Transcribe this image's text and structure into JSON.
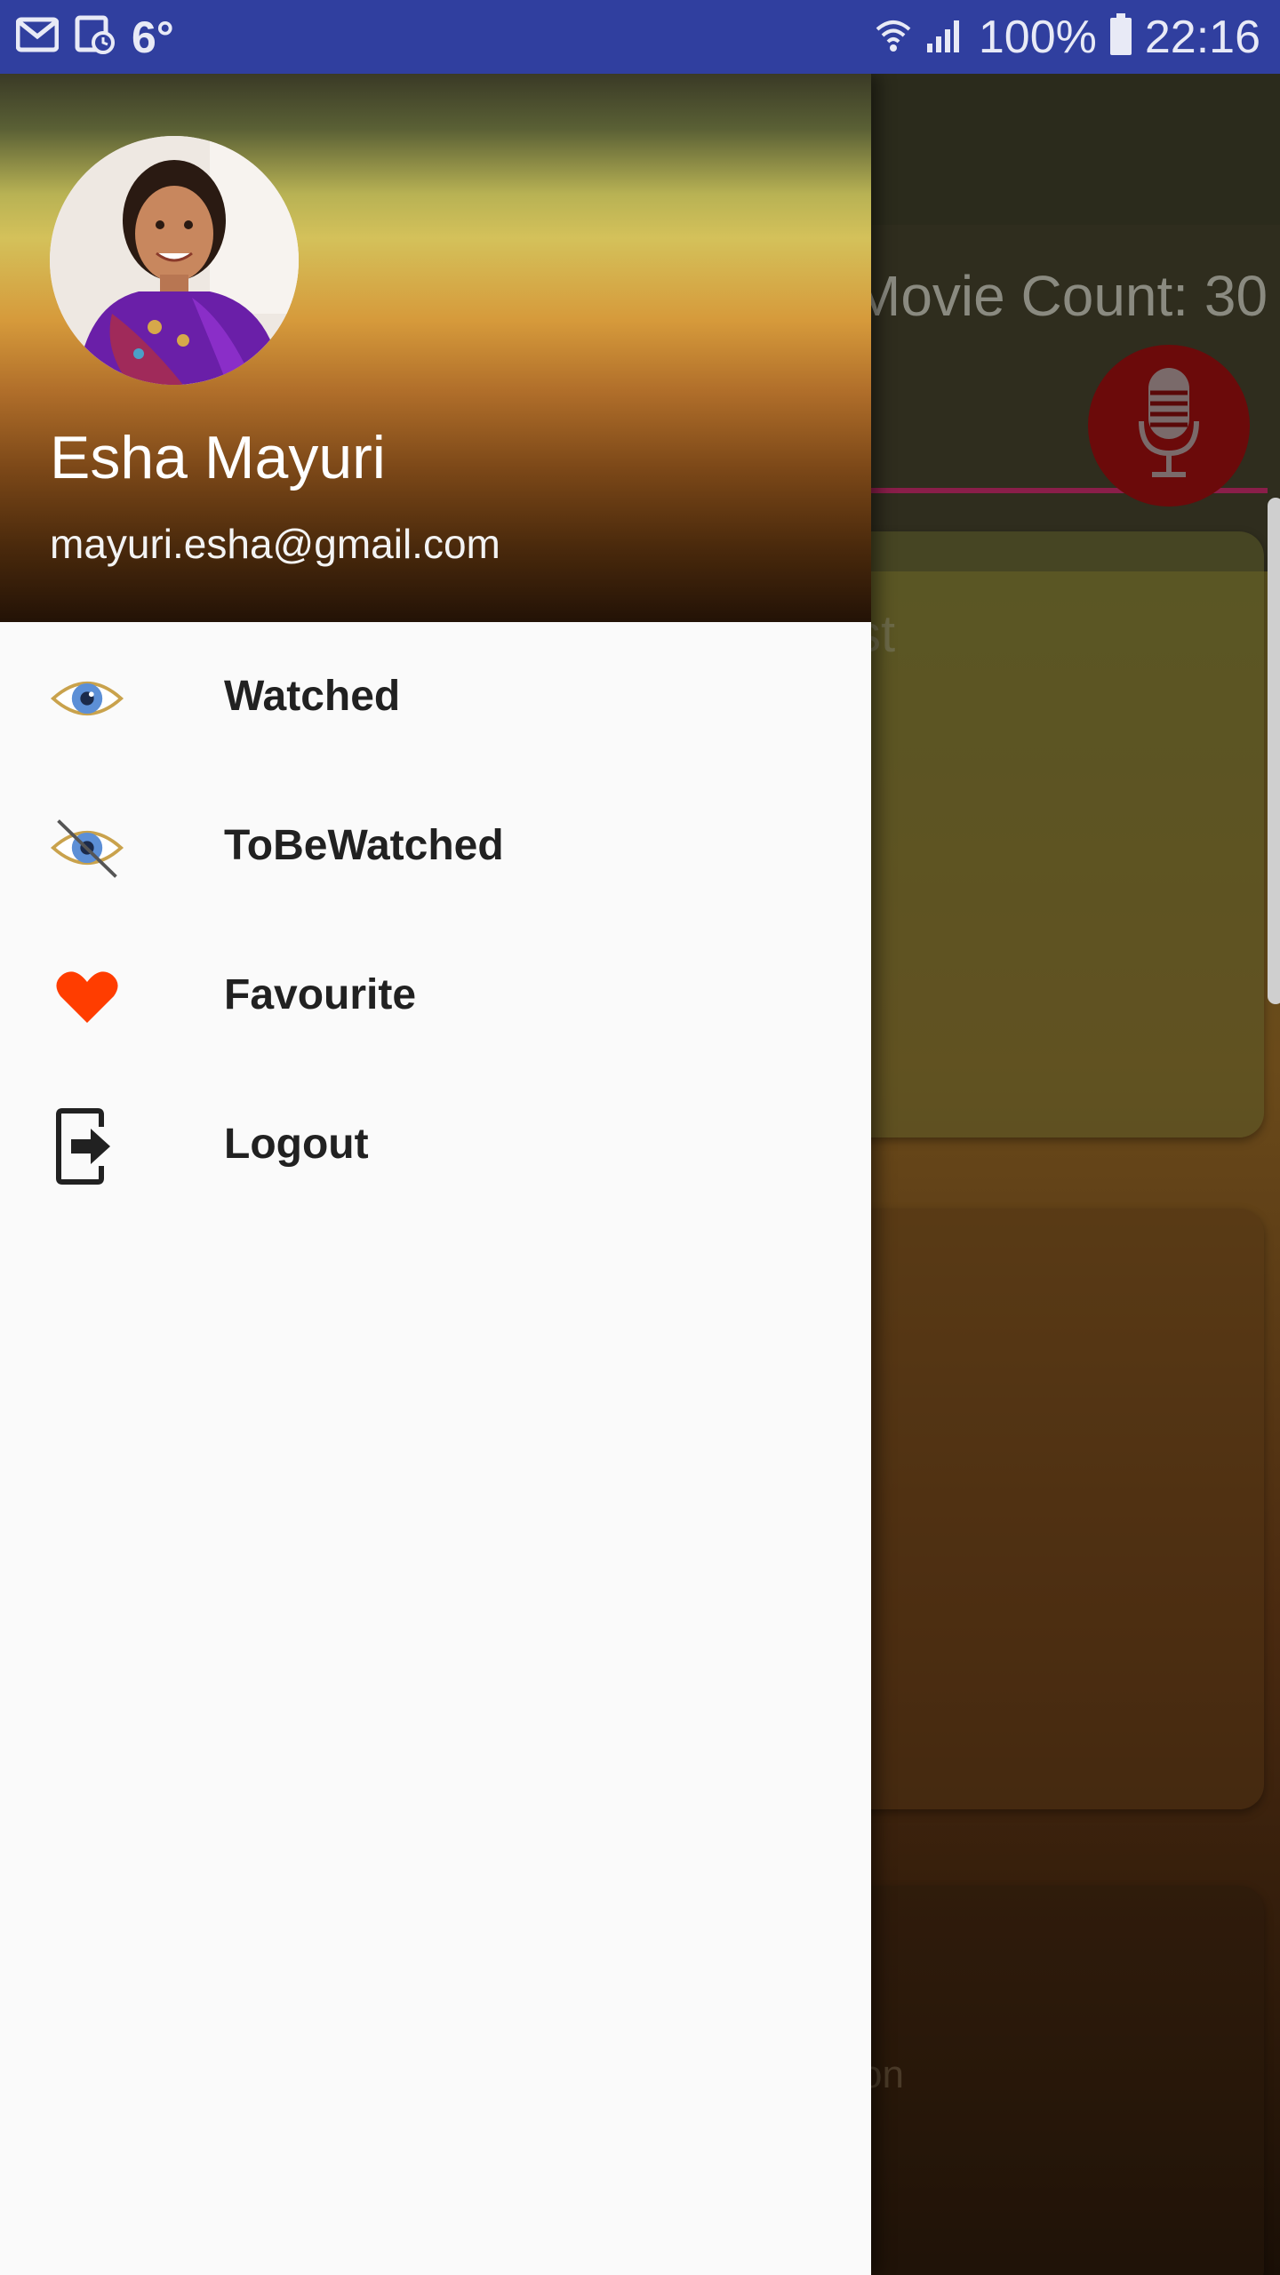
{
  "status_bar": {
    "temperature": "6°",
    "battery": "100%",
    "time": "22:16",
    "icons": [
      "gmail-icon",
      "calendar-clock-icon",
      "wifi-icon",
      "signal-icon",
      "battery-icon"
    ],
    "background_color": "#303f9f"
  },
  "background_app": {
    "movie_count_label": "Movie Count: 30",
    "card_1_text": "st",
    "card_3_text": "on",
    "mic_button_icon": "microphone-icon"
  },
  "drawer": {
    "user": {
      "name": "Esha Mayuri",
      "email": "mayuri.esha@gmail.com"
    },
    "items": [
      {
        "label": "Watched",
        "icon": "eye-icon"
      },
      {
        "label": "ToBeWatched",
        "icon": "eye-crossed-icon"
      },
      {
        "label": "Favourite",
        "icon": "heart-icon"
      },
      {
        "label": "Logout",
        "icon": "logout-icon"
      }
    ]
  },
  "colors": {
    "accent_pink": "#d81b60",
    "heart_red": "#ff3d00",
    "eye_blue": "#5c8fd6",
    "eye_outline": "#c9a24c"
  }
}
